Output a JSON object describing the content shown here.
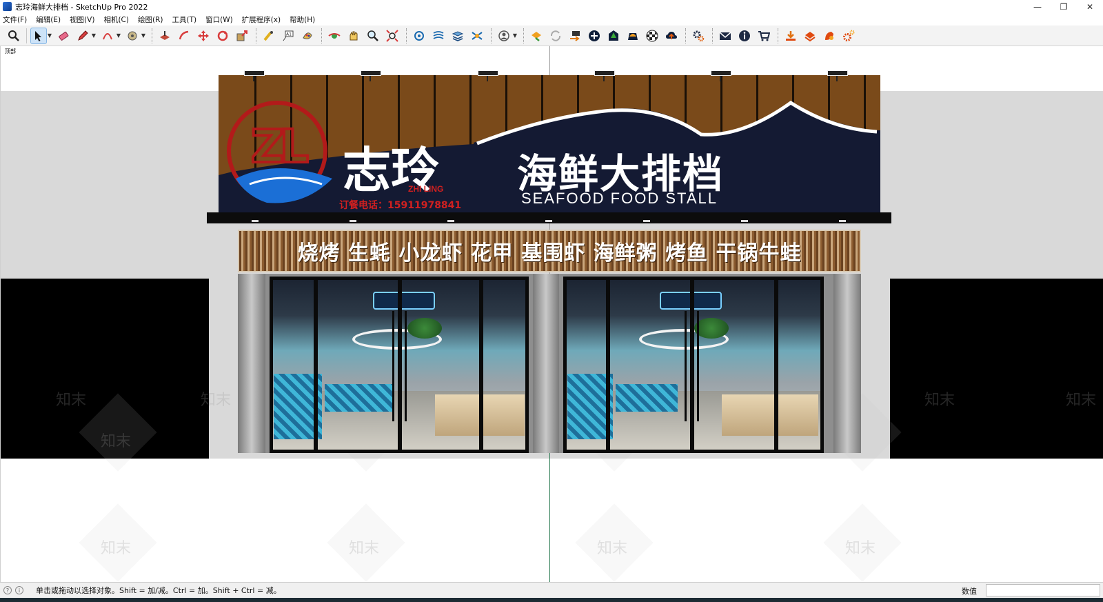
{
  "window": {
    "title": "志玲海鲜大排档 - SketchUp Pro 2022",
    "minimize": "—",
    "maximize": "❐",
    "close": "✕"
  },
  "menu": [
    "文件(F)",
    "编辑(E)",
    "视图(V)",
    "相机(C)",
    "绘图(R)",
    "工具(T)",
    "窗口(W)",
    "扩展程序(x)",
    "帮助(H)"
  ],
  "toolbar": {
    "icons": [
      "search-icon",
      "select-icon",
      "eraser-icon",
      "pencil-icon",
      "arc-icon",
      "paint-bucket-icon",
      "push-pull-icon",
      "follow-me-icon",
      "move-icon",
      "rotate-icon",
      "scale-icon",
      "tape-measure-icon",
      "text-icon",
      "paint-icon",
      "orbit-icon",
      "pan-icon",
      "zoom-icon",
      "zoom-extents-icon",
      "components-icon",
      "sandbox-icon",
      "layers-icon",
      "styles-icon",
      "user-icon",
      "warehouse-icon",
      "refresh-icon",
      "export-icon",
      "add-icon",
      "tree-icon",
      "solar-icon",
      "checker-icon",
      "cloud-icon",
      "settings-icon",
      "mail-icon",
      "info-icon",
      "cart-icon",
      "download-icon",
      "extension-icon",
      "ruby-icon",
      "gear-icon"
    ]
  },
  "viewport": {
    "scene_label": "顶部",
    "sign": {
      "logo_text": "ZL",
      "brand_cn": "志玲",
      "brand_en": "ZHI LING",
      "phone": "订餐电话：15911978841",
      "name_cn": "海鲜大排档",
      "name_en": "SEAFOOD FOOD STALL"
    },
    "band_text": "烧烤 生蚝 小龙虾 花甲 基围虾 海鲜粥 烤鱼 干锅牛蛙",
    "watermark": "知末"
  },
  "status": {
    "hint": "单击或拖动以选择对象。Shift = 加/减。Ctrl = 加。Shift + Ctrl = 减。",
    "measure_label": "数值",
    "measure_value": ""
  },
  "colors": {
    "wood": "#7a4a1a",
    "sign_navy": "#141a33",
    "logo_red": "#b21a1a",
    "logo_blue": "#1b6fd6",
    "phone_red": "#d02020",
    "accent": "#cde3f8"
  }
}
